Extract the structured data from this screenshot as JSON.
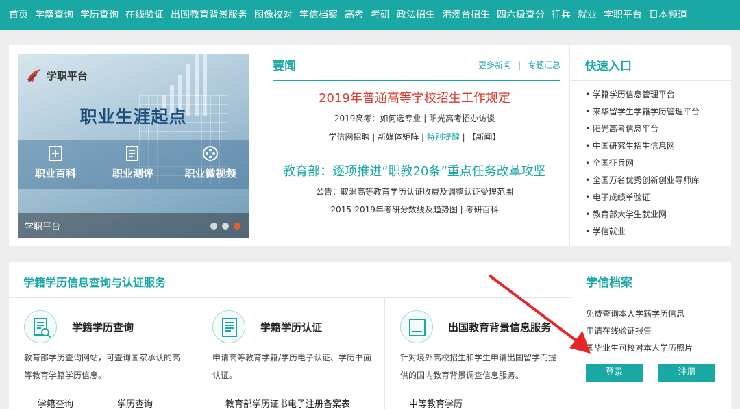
{
  "nav": {
    "items": [
      "首页",
      "学籍查询",
      "学历查询",
      "在线验证",
      "出国教育背景服务",
      "图像校对",
      "学信档案",
      "高考",
      "考研",
      "政法招生",
      "港澳台招生",
      "四六级查分",
      "征兵",
      "就业",
      "学职平台",
      "日本频道"
    ]
  },
  "carousel": {
    "brand": "学职平台",
    "headline": "职业生涯起点",
    "features": [
      "职业百科",
      "职业测评",
      "职业微视频"
    ],
    "caption": "学职平台",
    "slide_count": 3,
    "active_slide": 3
  },
  "news": {
    "title": "要闻",
    "more_link": "更多新闻",
    "topics_link": "专题汇总",
    "headline1": "2019年普通高等学校招生工作规定",
    "line1": "2019高考：如何选专业 | 阳光高考招办访谈",
    "line2_pre": "学信网招聘 | 新媒体矩阵 | ",
    "line2_hl": "特别提醒",
    "line2_post": " | 【新闻】",
    "headline2": "教育部：逐项推进“职教20条”重点任务改革攻坚",
    "line3": "公告：取消高等教育学历认证收费及调整认证受理范围",
    "line4": "2015-2019年考研分数线及趋势图 | 考研百科"
  },
  "quick": {
    "title": "快速入口",
    "items": [
      "• 学籍学历信息管理平台",
      "• 来华留学生学籍学历管理平台",
      "• 阳光高考信息平台",
      "• 中国研究生招生信息网",
      "• 全国征兵网",
      "• 全国万名优秀创新创业导师库",
      "• 电子成绩单验证",
      "• 教育部大学生就业网",
      "• 学信就业"
    ]
  },
  "services": {
    "title": "学籍学历信息查询与认证服务",
    "cols": [
      {
        "name": "学籍学历查询",
        "desc": "教育部学历查询网站，可查询国家承认的高等教育学籍学历信息。",
        "links": [
          "学籍查询",
          "学历查询"
        ]
      },
      {
        "name": "学籍学历认证",
        "desc": "申请高等教育学籍/学历电子认证、学历书面认证。",
        "links": [
          "教育部学历证书电子注册备案表"
        ]
      },
      {
        "name": "出国教育背景信息服务",
        "desc": "针对境外高校招生和学生申请出国留学而提供的国内教育背景调查信息服务。",
        "links": [
          "中等教育学历"
        ]
      }
    ]
  },
  "archive": {
    "title": "学信档案",
    "items": [
      "免费查询本人学籍学历信息",
      "申请在线验证报告",
      "国毕业生可校对本人学历照片"
    ],
    "login": "登录",
    "register": "注册"
  },
  "colors": {
    "brand": "#1aa8a4",
    "headline_red": "#d9392f",
    "arrow": "#e8262a",
    "active_dot": "#f05b2a"
  }
}
